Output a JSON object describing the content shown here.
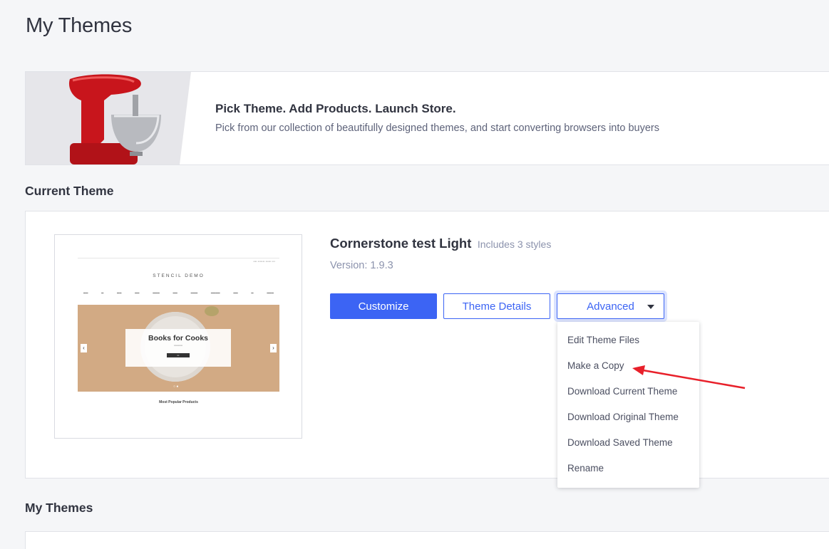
{
  "page": {
    "title": "My Themes"
  },
  "banner": {
    "title": "Pick Theme. Add Products. Launch Store.",
    "subtitle": "Pick from our collection of beautifully designed themes, and start converting browsers into buyers"
  },
  "current_theme": {
    "heading": "Current Theme",
    "name": "Cornerstone test Light",
    "styles": "Includes 3 styles",
    "version": "Version: 1.9.3",
    "buttons": {
      "customize": "Customize",
      "theme_details": "Theme Details",
      "advanced": "Advanced"
    },
    "preview": {
      "logo": "STENCIL DEMO",
      "hero_title": "Books for Cooks",
      "section_title": "Most Popular Products"
    }
  },
  "advanced_menu": {
    "items": [
      "Edit Theme Files",
      "Make a Copy",
      "Download Current Theme",
      "Download Original Theme",
      "Download Saved Theme",
      "Rename"
    ]
  },
  "my_themes": {
    "heading": "My Themes"
  },
  "colors": {
    "primary": "#3c64f4",
    "annotation_arrow": "#e8202a"
  }
}
